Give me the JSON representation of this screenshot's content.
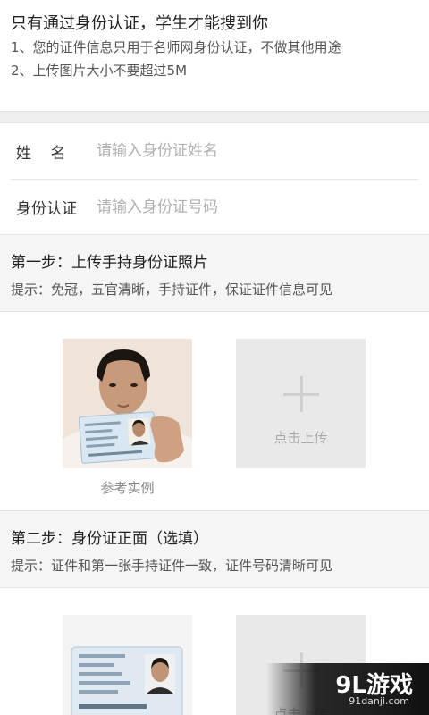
{
  "notice": {
    "title": "只有通过身份认证，学生才能搜到你",
    "line1": "1、您的证件信息只用于名师网身份认证，不做其他用途",
    "line2": "2、上传图片大小不要超过5M"
  },
  "form": {
    "name_label": "姓    名",
    "name_placeholder": "请输入身份证姓名",
    "id_label": "身份认证",
    "id_placeholder": "请输入身份证号码"
  },
  "step1": {
    "title": "第一步：上传手持身份证照片",
    "tip": "提示：免冠，五官清晰，手持证件，保证证件信息可见",
    "example_caption": "参考实例",
    "upload_label": "点击上传"
  },
  "step2": {
    "title": "第二步：身份证正面（选填）",
    "tip": "提示：证件和第一张手持证件一致，证件号码清晰可见",
    "upload_label": "点击上传"
  },
  "watermark": {
    "mark": "9L游戏",
    "url": "91danji.com"
  }
}
